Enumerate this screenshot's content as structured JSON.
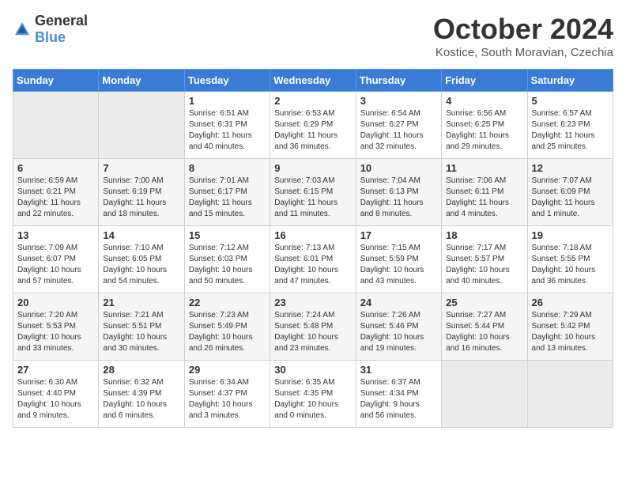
{
  "header": {
    "logo_general": "General",
    "logo_blue": "Blue",
    "month_title": "October 2024",
    "location": "Kostice, South Moravian, Czechia"
  },
  "days_of_week": [
    "Sunday",
    "Monday",
    "Tuesday",
    "Wednesday",
    "Thursday",
    "Friday",
    "Saturday"
  ],
  "weeks": [
    [
      {
        "day": "",
        "info": ""
      },
      {
        "day": "",
        "info": ""
      },
      {
        "day": "1",
        "info": "Sunrise: 6:51 AM\nSunset: 6:31 PM\nDaylight: 11 hours\nand 40 minutes."
      },
      {
        "day": "2",
        "info": "Sunrise: 6:53 AM\nSunset: 6:29 PM\nDaylight: 11 hours\nand 36 minutes."
      },
      {
        "day": "3",
        "info": "Sunrise: 6:54 AM\nSunset: 6:27 PM\nDaylight: 11 hours\nand 32 minutes."
      },
      {
        "day": "4",
        "info": "Sunrise: 6:56 AM\nSunset: 6:25 PM\nDaylight: 11 hours\nand 29 minutes."
      },
      {
        "day": "5",
        "info": "Sunrise: 6:57 AM\nSunset: 6:23 PM\nDaylight: 11 hours\nand 25 minutes."
      }
    ],
    [
      {
        "day": "6",
        "info": "Sunrise: 6:59 AM\nSunset: 6:21 PM\nDaylight: 11 hours\nand 22 minutes."
      },
      {
        "day": "7",
        "info": "Sunrise: 7:00 AM\nSunset: 6:19 PM\nDaylight: 11 hours\nand 18 minutes."
      },
      {
        "day": "8",
        "info": "Sunrise: 7:01 AM\nSunset: 6:17 PM\nDaylight: 11 hours\nand 15 minutes."
      },
      {
        "day": "9",
        "info": "Sunrise: 7:03 AM\nSunset: 6:15 PM\nDaylight: 11 hours\nand 11 minutes."
      },
      {
        "day": "10",
        "info": "Sunrise: 7:04 AM\nSunset: 6:13 PM\nDaylight: 11 hours\nand 8 minutes."
      },
      {
        "day": "11",
        "info": "Sunrise: 7:06 AM\nSunset: 6:11 PM\nDaylight: 11 hours\nand 4 minutes."
      },
      {
        "day": "12",
        "info": "Sunrise: 7:07 AM\nSunset: 6:09 PM\nDaylight: 11 hours\nand 1 minute."
      }
    ],
    [
      {
        "day": "13",
        "info": "Sunrise: 7:09 AM\nSunset: 6:07 PM\nDaylight: 10 hours\nand 57 minutes."
      },
      {
        "day": "14",
        "info": "Sunrise: 7:10 AM\nSunset: 6:05 PM\nDaylight: 10 hours\nand 54 minutes."
      },
      {
        "day": "15",
        "info": "Sunrise: 7:12 AM\nSunset: 6:03 PM\nDaylight: 10 hours\nand 50 minutes."
      },
      {
        "day": "16",
        "info": "Sunrise: 7:13 AM\nSunset: 6:01 PM\nDaylight: 10 hours\nand 47 minutes."
      },
      {
        "day": "17",
        "info": "Sunrise: 7:15 AM\nSunset: 5:59 PM\nDaylight: 10 hours\nand 43 minutes."
      },
      {
        "day": "18",
        "info": "Sunrise: 7:17 AM\nSunset: 5:57 PM\nDaylight: 10 hours\nand 40 minutes."
      },
      {
        "day": "19",
        "info": "Sunrise: 7:18 AM\nSunset: 5:55 PM\nDaylight: 10 hours\nand 36 minutes."
      }
    ],
    [
      {
        "day": "20",
        "info": "Sunrise: 7:20 AM\nSunset: 5:53 PM\nDaylight: 10 hours\nand 33 minutes."
      },
      {
        "day": "21",
        "info": "Sunrise: 7:21 AM\nSunset: 5:51 PM\nDaylight: 10 hours\nand 30 minutes."
      },
      {
        "day": "22",
        "info": "Sunrise: 7:23 AM\nSunset: 5:49 PM\nDaylight: 10 hours\nand 26 minutes."
      },
      {
        "day": "23",
        "info": "Sunrise: 7:24 AM\nSunset: 5:48 PM\nDaylight: 10 hours\nand 23 minutes."
      },
      {
        "day": "24",
        "info": "Sunrise: 7:26 AM\nSunset: 5:46 PM\nDaylight: 10 hours\nand 19 minutes."
      },
      {
        "day": "25",
        "info": "Sunrise: 7:27 AM\nSunset: 5:44 PM\nDaylight: 10 hours\nand 16 minutes."
      },
      {
        "day": "26",
        "info": "Sunrise: 7:29 AM\nSunset: 5:42 PM\nDaylight: 10 hours\nand 13 minutes."
      }
    ],
    [
      {
        "day": "27",
        "info": "Sunrise: 6:30 AM\nSunset: 4:40 PM\nDaylight: 10 hours\nand 9 minutes."
      },
      {
        "day": "28",
        "info": "Sunrise: 6:32 AM\nSunset: 4:39 PM\nDaylight: 10 hours\nand 6 minutes."
      },
      {
        "day": "29",
        "info": "Sunrise: 6:34 AM\nSunset: 4:37 PM\nDaylight: 10 hours\nand 3 minutes."
      },
      {
        "day": "30",
        "info": "Sunrise: 6:35 AM\nSunset: 4:35 PM\nDaylight: 10 hours\nand 0 minutes."
      },
      {
        "day": "31",
        "info": "Sunrise: 6:37 AM\nSunset: 4:34 PM\nDaylight: 9 hours\nand 56 minutes."
      },
      {
        "day": "",
        "info": ""
      },
      {
        "day": "",
        "info": ""
      }
    ]
  ]
}
